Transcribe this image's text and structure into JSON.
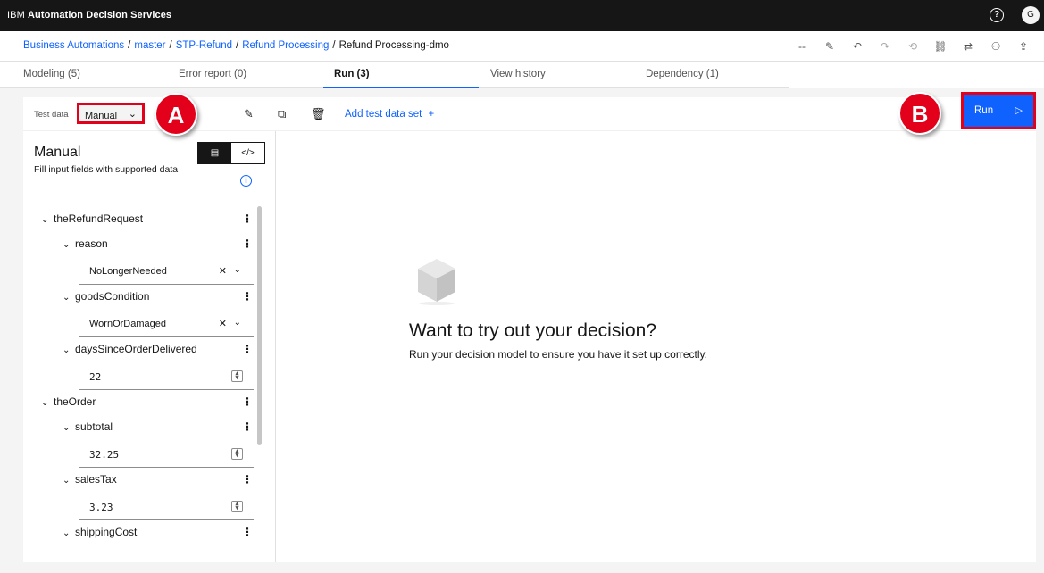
{
  "app": {
    "brand_prefix": "IBM",
    "brand_name": "Automation Decision Services",
    "help_glyph": "?",
    "avatar_initial": "G"
  },
  "breadcrumb": {
    "items": [
      "Business Automations",
      "master",
      "STP-Refund",
      "Refund Processing"
    ],
    "current": "Refund Processing-dmo",
    "separator": "/"
  },
  "crumb_actions": [
    "--",
    "edit-icon",
    "undo-icon",
    "redo-icon",
    "history-icon",
    "disconnect-icon",
    "sync-icon",
    "share-user-icon",
    "upload-icon"
  ],
  "tabs": [
    {
      "label": "Modeling (5)"
    },
    {
      "label": "Error report (0)"
    },
    {
      "label": "Run (3)"
    },
    {
      "label": "View history"
    },
    {
      "label": "Dependency (1)"
    }
  ],
  "toolbar": {
    "test_data_label": "Test data",
    "test_data_value": "Manual",
    "add_test_data": "Add test data set",
    "add_plus": "+",
    "run_label": "Run"
  },
  "markers": {
    "a": "A",
    "b": "B"
  },
  "panel": {
    "title": "Manual",
    "subtitle": "Fill input fields with supported data",
    "toggle_form": "▤",
    "toggle_code": "</>"
  },
  "tree": {
    "refund_request": "theRefundRequest",
    "reason": "reason",
    "reason_value": "NoLongerNeeded",
    "goods_condition": "goodsCondition",
    "goods_condition_value": "WornOrDamaged",
    "days_since": "daysSinceOrderDelivered",
    "days_since_value": "22",
    "order": "theOrder",
    "subtotal": "subtotal",
    "subtotal_value": "32.25",
    "sales_tax": "salesTax",
    "sales_tax_value": "3.23",
    "shipping_cost": "shippingCost"
  },
  "empty_state": {
    "title": "Want to try out your decision?",
    "subtitle": "Run your decision model to ensure you have it set up correctly."
  },
  "colors": {
    "accent": "#0f62fe",
    "highlight": "#e3001b",
    "topbar": "#161616"
  }
}
